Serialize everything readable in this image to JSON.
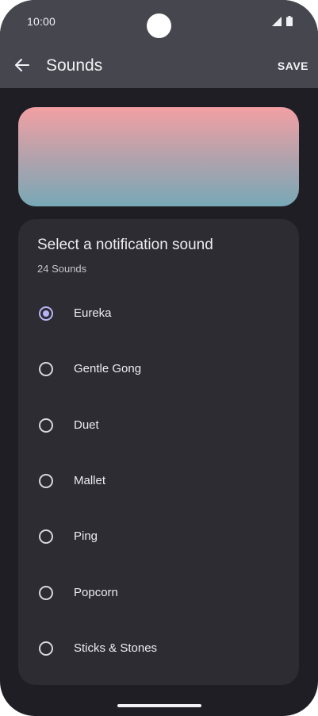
{
  "status_bar": {
    "time": "10:00",
    "icons": [
      "signal-icon",
      "battery-icon"
    ]
  },
  "app_bar": {
    "back_icon": "arrow-left-icon",
    "title": "Sounds",
    "save_label": "SAVE"
  },
  "card": {
    "title": "Select a notification sound",
    "count": "24 Sounds",
    "sounds": [
      {
        "label": "Eureka",
        "selected": true
      },
      {
        "label": "Gentle Gong",
        "selected": false
      },
      {
        "label": "Duet",
        "selected": false
      },
      {
        "label": "Mallet",
        "selected": false
      },
      {
        "label": "Ping",
        "selected": false
      },
      {
        "label": "Popcorn",
        "selected": false
      },
      {
        "label": "Sticks & Stones",
        "selected": false
      }
    ]
  },
  "colors": {
    "background": "#1f1e24",
    "app_bar": "#46464e",
    "card": "#2d2c32",
    "accent": "#b9b4f5",
    "preview_top": "#f3a0a3",
    "preview_bottom": "#78a8b6"
  }
}
